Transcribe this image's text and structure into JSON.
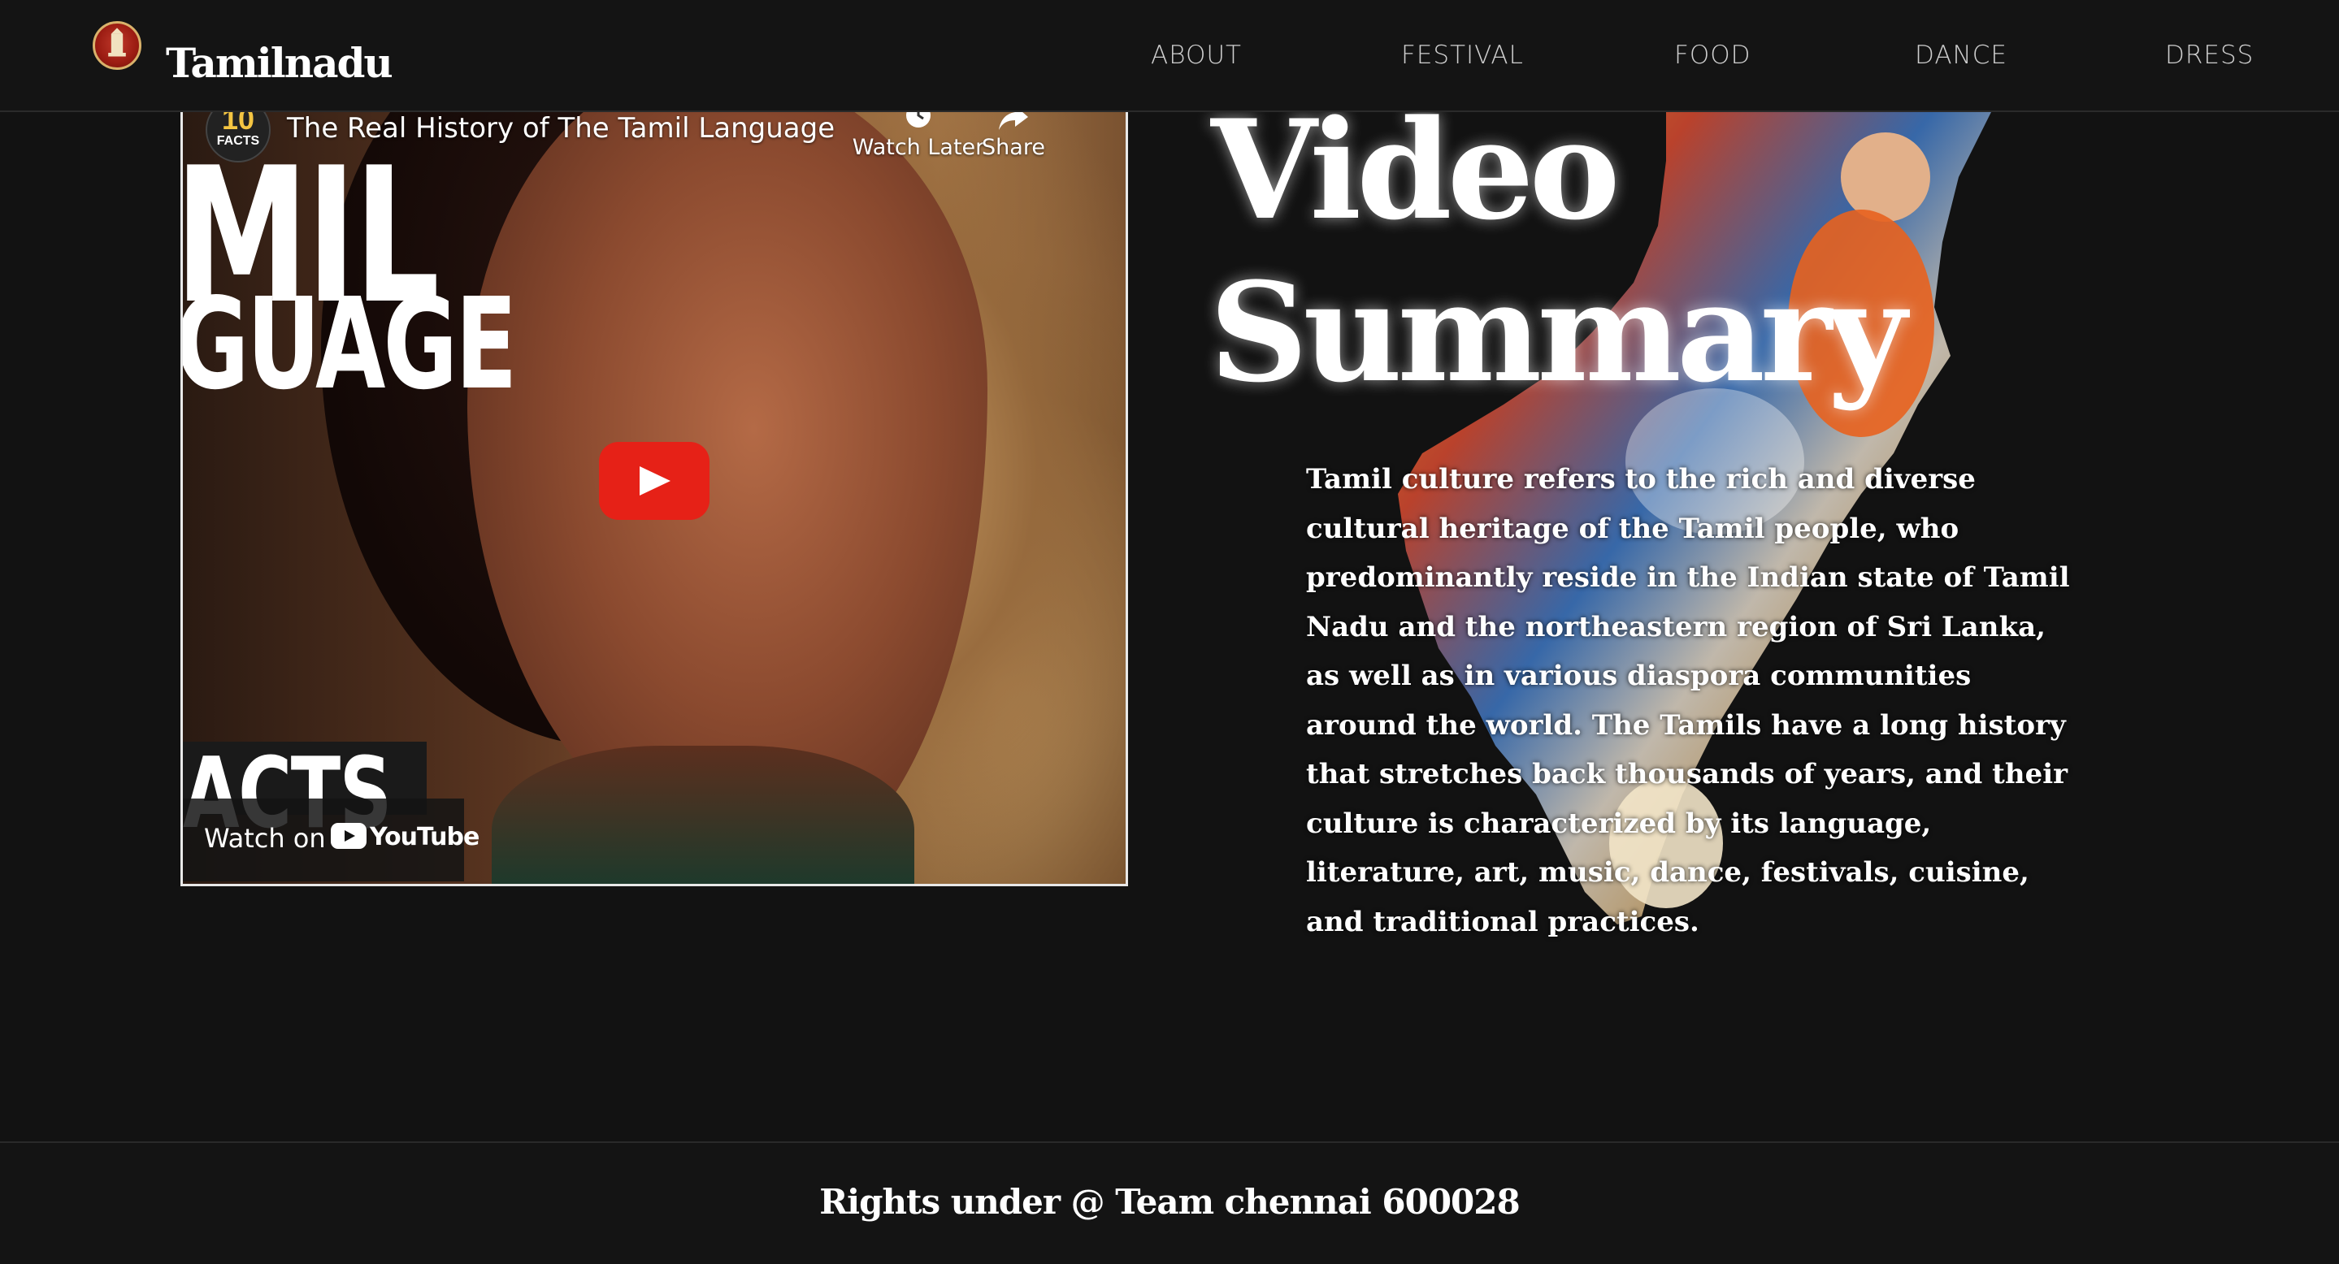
{
  "nav": {
    "brand": "Tamilnadu",
    "links": [
      "ABOUT",
      "FESTIVAL",
      "FOOD",
      "DANCE",
      "DRESS"
    ]
  },
  "video": {
    "title": "The Real History of The Tamil Language",
    "channel_badge": {
      "number": "10",
      "label": "FACTS"
    },
    "watch_later": "Watch Later",
    "share": "Share",
    "watch_on": "Watch on",
    "youtube": "YouTube",
    "thumbnail_text": {
      "line1": "MIL",
      "line2": "GUAGE",
      "line3": "ACTS"
    }
  },
  "summary": {
    "heading_line1": "Video",
    "heading_line2": "Summary",
    "body": "Tamil culture refers to the rich and diverse cultural heritage of the Tamil people, who predominantly reside in the Indian state of Tamil Nadu and the northeastern region of Sri Lanka, as well as in various diaspora communities around the world. The Tamils have a long history that stretches back thousands of years, and their culture is characterized by its language, literature, art, music, dance, festivals, cuisine, and traditional practices."
  },
  "footer": {
    "text": "Rights under @ Team chennai 600028"
  },
  "colors": {
    "background": "#121212",
    "youtube_red": "#e62117",
    "text": "#ffffff"
  }
}
